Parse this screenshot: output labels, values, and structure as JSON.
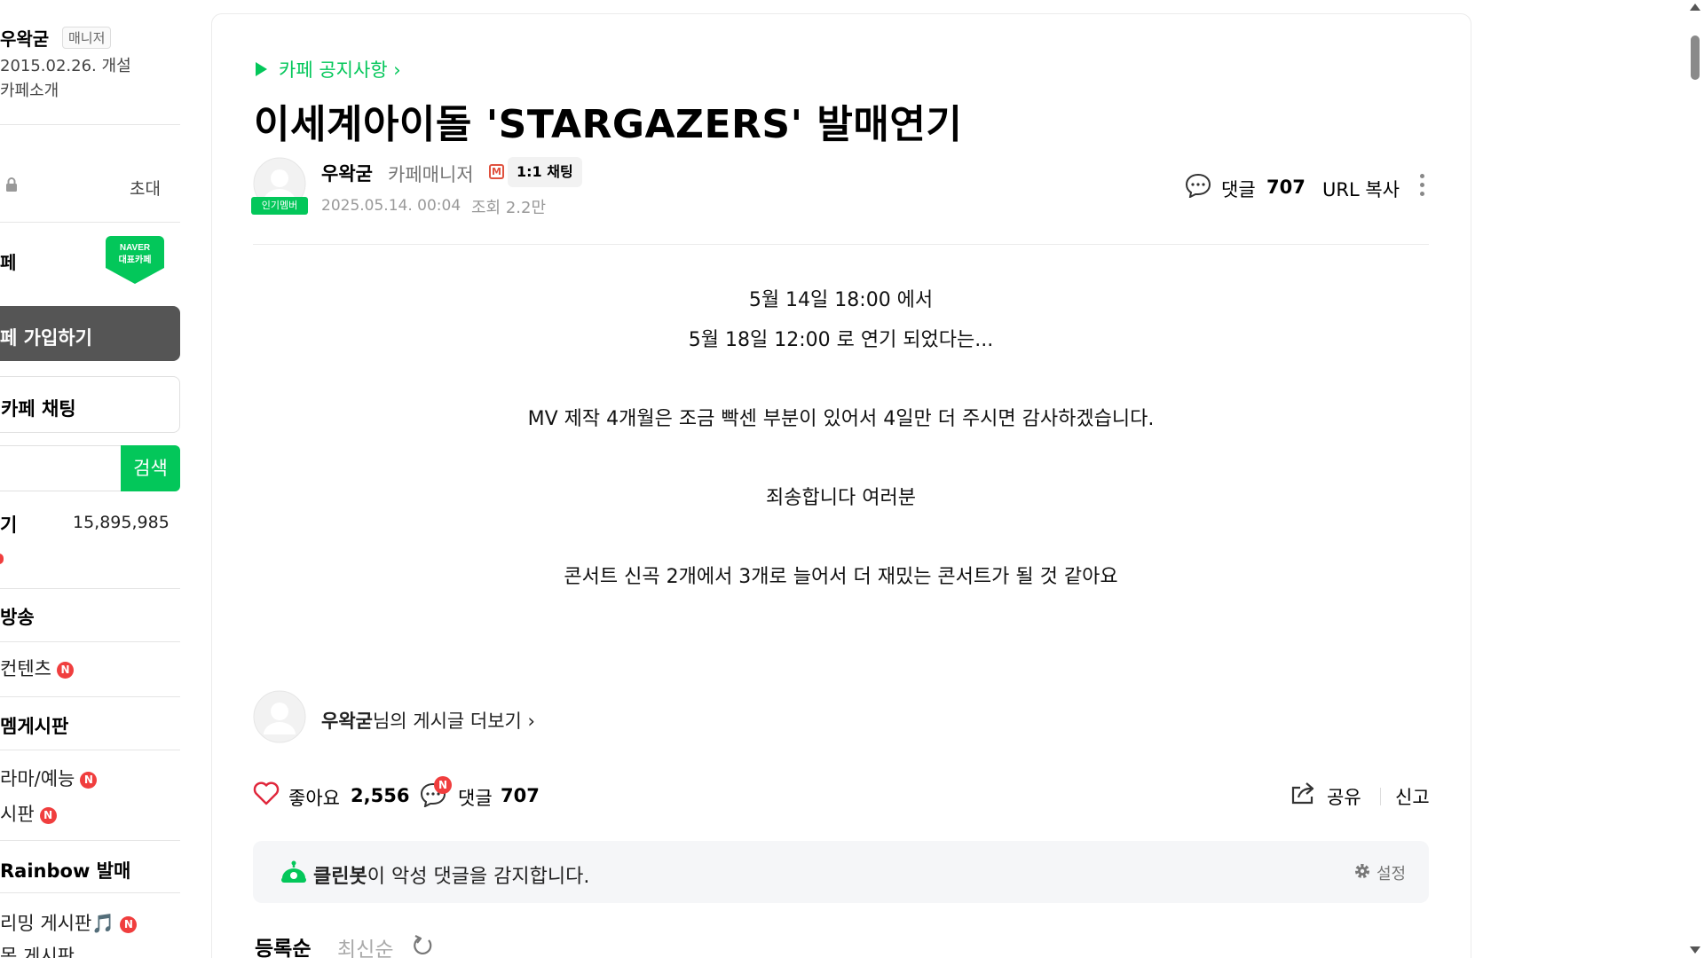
{
  "sidebar": {
    "manager_name": "우왁굳",
    "manager_badge": "매니저",
    "founded": "2015.02.26. 개설",
    "about": "카페소개",
    "invite": "초대",
    "cafe_label": "페",
    "naver_badge_line1": "NAVER",
    "naver_badge_line2": "대표카페",
    "join_button": "페 가입하기",
    "chat_button": "카페 채팅",
    "search_button": "검색",
    "members_label": "기",
    "members_count": "15,895,985",
    "menus": [
      {
        "label": "방송",
        "bold": true
      },
      {
        "label": "컨텐츠",
        "bold": false,
        "new": "N"
      },
      {
        "label": "멤게시판",
        "bold": true
      },
      {
        "label": "라마/예능",
        "bold": false,
        "new": "N"
      },
      {
        "label": "시판",
        "bold": false,
        "new": "N"
      },
      {
        "label": "Rainbow 발매",
        "bold": true
      },
      {
        "label": "리밍 게시판🎵",
        "bold": false,
        "new": "N"
      },
      {
        "label": "목 게시판",
        "bold": false
      }
    ]
  },
  "post": {
    "breadcrumb": "카페 공지사항 ›",
    "title": "이세계아이돌 'STARGAZERS' 발매연기",
    "author": "우왁굳",
    "author_role": "카페매니저",
    "manager_icon": "M",
    "chat_label": "1:1 채팅",
    "popular_badge": "인기멤버",
    "date": "2025.05.14. 00:04",
    "views": "조회 2.2만",
    "comment_label": "댓글",
    "comment_count": "707",
    "url_copy": "URL 복사",
    "body": [
      "5월 14일 18:00 에서",
      "5월 18일 12:00 로 연기 되었다는...",
      "MV 제작 4개월은 조금 빡센 부분이 있어서 4일만 더 주시면 감사하겠습니다.",
      "죄송합니다 여러분",
      "콘서트 신곡 2개에서 3개로 늘어서 더 재밌는 콘서트가 될 것 같아요"
    ],
    "more_author": "우왁굳",
    "more_suffix": "님의 게시글 더보기 ›"
  },
  "actions": {
    "like_label": "좋아요",
    "like_count": "2,556",
    "comment_new": "N",
    "comment_label": "댓글",
    "comment_count": "707",
    "share": "공유",
    "report": "신고"
  },
  "cleanbot": {
    "name": "클린봇",
    "text": "이 악성 댓글을 감지합니다.",
    "settings": "설정"
  },
  "sort": {
    "registered": "등록순",
    "newest": "최신순"
  },
  "colors": {
    "accent_green": "#03c75a",
    "badge_red": "#f03e3e",
    "join_button_bg": "#555555"
  }
}
